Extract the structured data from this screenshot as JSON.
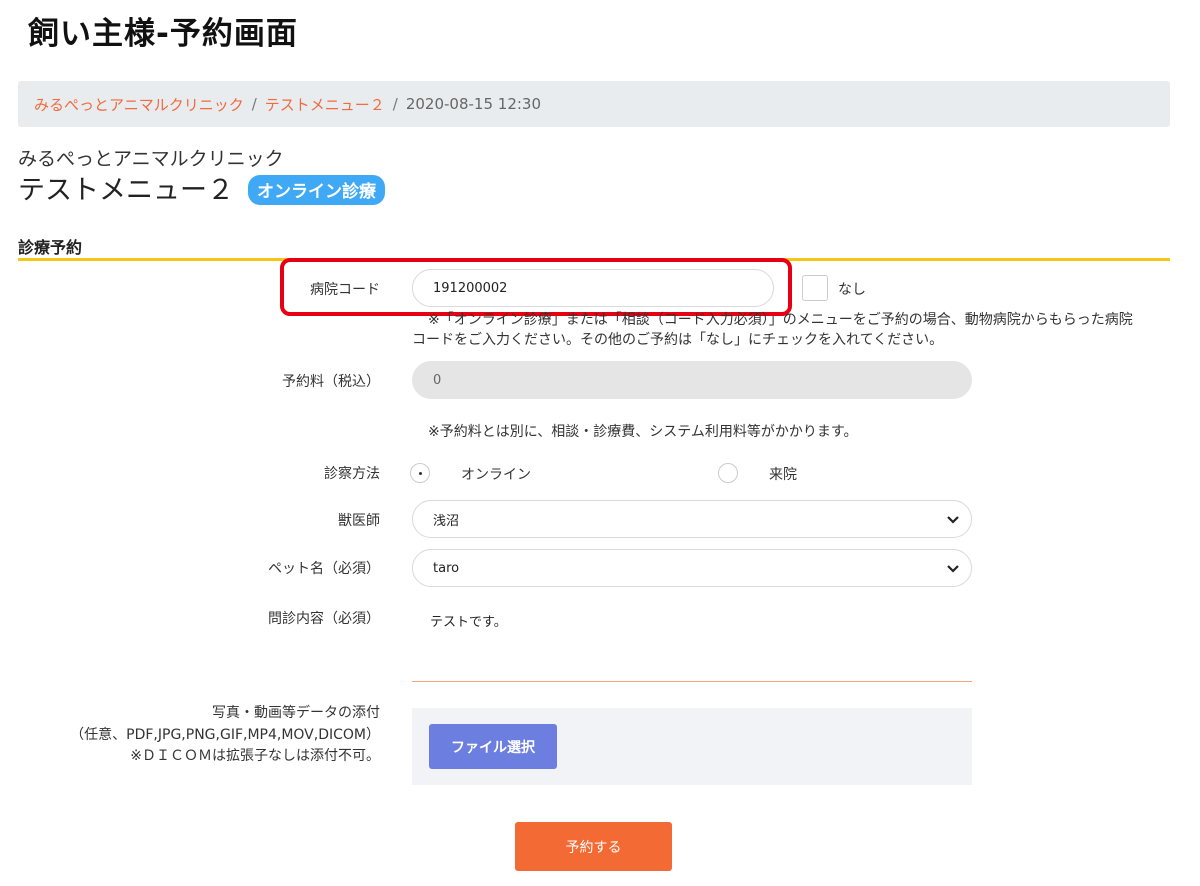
{
  "page_title": "飼い主様-予約画面",
  "breadcrumb": {
    "clinic_link": "みるぺっとアニマルクリニック",
    "menu_link": "テストメニュー２",
    "separator": "/",
    "datetime": "2020-08-15 12:30"
  },
  "clinic_name": "みるぺっとアニマルクリニック",
  "menu_title": "テストメニュー２",
  "menu_badge": "オンライン診療",
  "section_heading": "診療予約",
  "form": {
    "hospital_code": {
      "label": "病院コード",
      "value": "191200002",
      "checkbox_label": "なし",
      "note_line1": "※「オンライン診療」または「相談（コード入力必須）」のメニューをご予約の場合、動物病院からもらった病院",
      "note_line2": "コードをご入力ください。その他のご予約は「なし」にチェックを入れてください。"
    },
    "fee": {
      "label": "予約料（税込）",
      "value": "0",
      "note": "※予約料とは別に、相談・診療費、システム利用料等がかかります。"
    },
    "method": {
      "label": "診察方法",
      "options": [
        "オンライン",
        "来院"
      ],
      "selected": "オンライン"
    },
    "vet": {
      "label": "獣医師",
      "value": "浅沼"
    },
    "pet": {
      "label": "ペット名（必須）",
      "value": "taro"
    },
    "consultation": {
      "label": "問診内容（必須）",
      "value": "テストです。"
    },
    "attachment": {
      "label_line1": "写真・動画等データの添付",
      "label_line2": "（任意、PDF,JPG,PNG,GIF,MP4,MOV,DICOM）",
      "label_line3": "※ＤＩＣＯＭは拡張子なしは添付不可。",
      "button_label": "ファイル選択"
    },
    "submit_label": "予約する"
  },
  "colors": {
    "accent_orange": "#f46a35",
    "link_orange": "#f26a3d",
    "badge_blue": "#3fa9f5",
    "section_line_yellow": "#f5c518",
    "highlight_red": "#e60012",
    "file_button_blue": "#6c7ee0"
  },
  "icons": {
    "select_arrow": "chevron-down-icon"
  }
}
